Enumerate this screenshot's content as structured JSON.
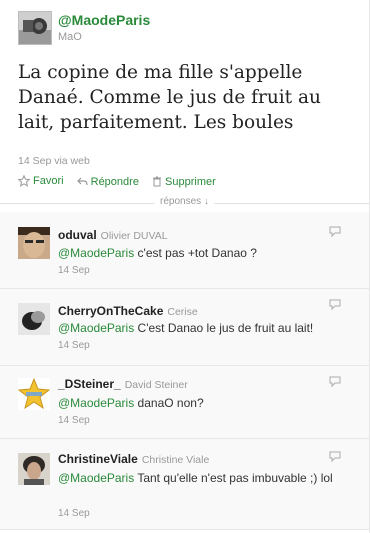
{
  "tweet": {
    "handle": "@MaodeParis",
    "name": "MaO",
    "text": "La copine de ma fille s'appelle Danaé. Comme le jus de fruit au lait, parfaitement. Les boules",
    "meta": "14 Sep  via web",
    "actions": {
      "favorite": "Favori",
      "reply": "Répondre",
      "delete": "Supprimer"
    }
  },
  "replies_label": "réponses ↓",
  "replies": [
    {
      "user": "oduval",
      "full_name": "Olivier DUVAL",
      "mention": "@MaodeParis",
      "text": " c'est pas +tot Danao ?",
      "time": "14 Sep"
    },
    {
      "user": "CherryOnTheCake",
      "full_name": "Cerise",
      "mention": "@MaodeParis",
      "text": " C'est Danao le jus de fruit au lait!",
      "time": "14 Sep"
    },
    {
      "user": "_DSteiner_",
      "full_name": "David Steiner",
      "mention": "@MaodeParis",
      "text": " danaO non?",
      "time": "14 Sep"
    },
    {
      "user": "ChristineViale",
      "full_name": "Christine Viale",
      "mention": "@MaodeParis",
      "text": " Tant qu'elle n'est pas imbuvable ;) lol",
      "time": "14 Sep"
    }
  ],
  "colors": {
    "link": "#2a8a3a",
    "muted": "#999999"
  }
}
